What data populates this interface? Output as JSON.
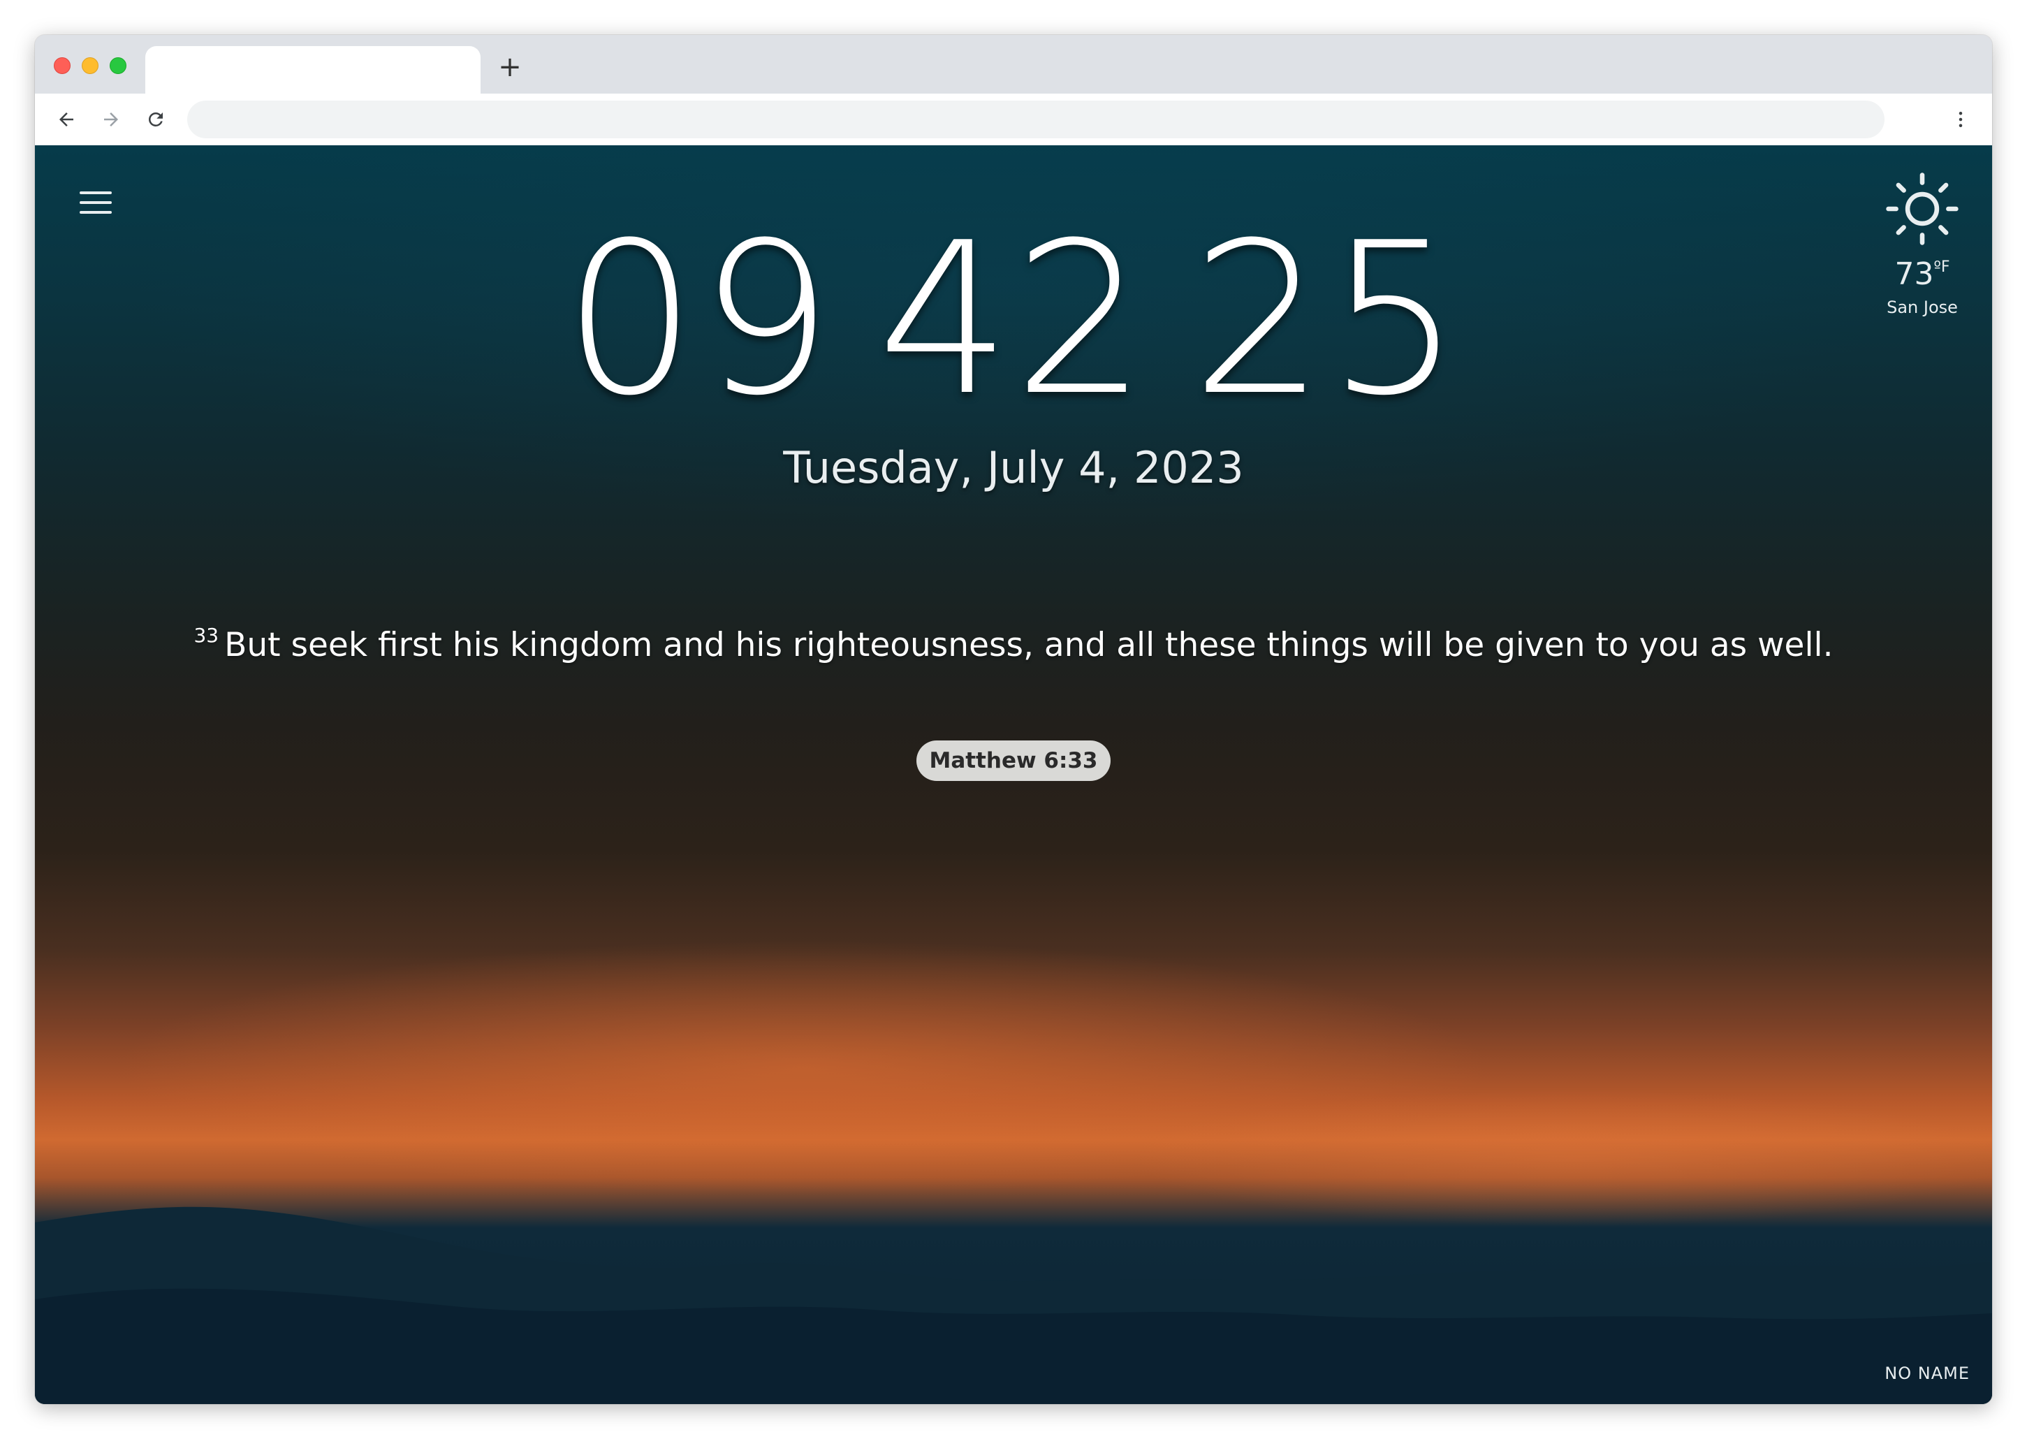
{
  "browser": {
    "tab_title": "",
    "new_tab_label": "+",
    "address": ""
  },
  "icons": {
    "back": "arrow-left-icon",
    "forward": "arrow-right-icon",
    "reload": "reload-icon",
    "menu": "kebab-menu-icon",
    "hamburger": "hamburger-menu-icon",
    "weather": "sun-icon"
  },
  "clock": {
    "hours": "09",
    "minutes": "42",
    "seconds": "25"
  },
  "date": "Tuesday, July 4, 2023",
  "verse": {
    "number": "33",
    "text": "But seek first his kingdom and his righteousness, and all these things will be given to you as well.",
    "reference": "Matthew 6:33"
  },
  "weather": {
    "temperature": "73",
    "unit": "ºF",
    "city": "San Jose"
  },
  "photo_credit": "NO NAME",
  "colors": {
    "sky_top": "#063b4a",
    "sunset_orange": "#d06a31",
    "reference_pill": "#d9d9d6"
  }
}
